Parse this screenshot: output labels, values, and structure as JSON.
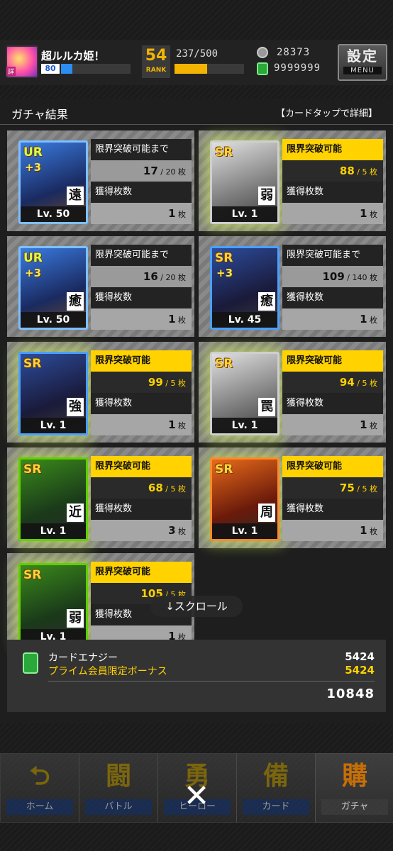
{
  "status": {
    "player_name": "超ルルカ姫！",
    "avatar_tag": "詳",
    "level": "80",
    "rank_value": "54",
    "rank_label": "RANK",
    "stamina": "237/500",
    "coins": "28373",
    "energy": "9999999",
    "settings_label": "設定",
    "menu_label": "MENU",
    "exp_progress": 0.16,
    "stamina_progress": 0.47
  },
  "panel": {
    "title": "ガチャ結果",
    "hint": "【カードタップで詳細】"
  },
  "cards": [
    {
      "rarity": "UR",
      "plus": "+3",
      "type": "遠",
      "level": "Lv. 50",
      "status": "限界突破可能まで",
      "count": "17",
      "max": "20",
      "unit": "枚",
      "acq_label": "獲得枚数",
      "acq": "1",
      "acq_unit": "枚"
    },
    {
      "rarity": "SR",
      "plus": "",
      "type": "弱",
      "level": "Lv. 1",
      "status": "限界突破可能",
      "count": "88",
      "max": "5",
      "unit": "枚",
      "acq_label": "獲得枚数",
      "acq": "1",
      "acq_unit": "枚"
    },
    {
      "rarity": "UR",
      "plus": "+3",
      "type": "癒",
      "level": "Lv. 50",
      "status": "限界突破可能まで",
      "count": "16",
      "max": "20",
      "unit": "枚",
      "acq_label": "獲得枚数",
      "acq": "1",
      "acq_unit": "枚"
    },
    {
      "rarity": "SR",
      "plus": "+3",
      "type": "癒",
      "level": "Lv. 45",
      "status": "限界突破可能まで",
      "count": "109",
      "max": "140",
      "unit": "枚",
      "acq_label": "獲得枚数",
      "acq": "1",
      "acq_unit": "枚"
    },
    {
      "rarity": "SR",
      "plus": "",
      "type": "強",
      "level": "Lv. 1",
      "status": "限界突破可能",
      "count": "99",
      "max": "5",
      "unit": "枚",
      "acq_label": "獲得枚数",
      "acq": "1",
      "acq_unit": "枚"
    },
    {
      "rarity": "SR",
      "plus": "",
      "type": "罠",
      "level": "Lv. 1",
      "status": "限界突破可能",
      "count": "94",
      "max": "5",
      "unit": "枚",
      "acq_label": "獲得枚数",
      "acq": "1",
      "acq_unit": "枚"
    },
    {
      "rarity": "SR",
      "plus": "",
      "type": "近",
      "level": "Lv. 1",
      "status": "限界突破可能",
      "count": "68",
      "max": "5",
      "unit": "枚",
      "acq_label": "獲得枚数",
      "acq": "3",
      "acq_unit": "枚"
    },
    {
      "rarity": "SR",
      "plus": "",
      "type": "周",
      "level": "Lv. 1",
      "status": "限界突破可能",
      "count": "75",
      "max": "5",
      "unit": "枚",
      "acq_label": "獲得枚数",
      "acq": "1",
      "acq_unit": "枚"
    },
    {
      "rarity": "SR",
      "plus": "",
      "type": "弱",
      "level": "Lv. 1",
      "status": "限界突破可能",
      "count": "105",
      "max": "5",
      "unit": "枚",
      "acq_label": "獲得枚数",
      "acq": "1",
      "acq_unit": "枚"
    }
  ],
  "scroll_label": "↓スクロール",
  "bonus": {
    "energy_label": "カードエナジー",
    "energy_value": "5424",
    "prime_label": "プライム会員限定ボーナス",
    "prime_value": "5424",
    "total": "10848"
  },
  "nav": [
    {
      "label": "ホーム",
      "icon": "⮌"
    },
    {
      "label": "バトル",
      "icon": "闘"
    },
    {
      "label": "ヒーロー",
      "icon": "勇"
    },
    {
      "label": "カード",
      "icon": "備"
    },
    {
      "label": "ガチャ",
      "icon": "購"
    }
  ],
  "close_label": "✕"
}
